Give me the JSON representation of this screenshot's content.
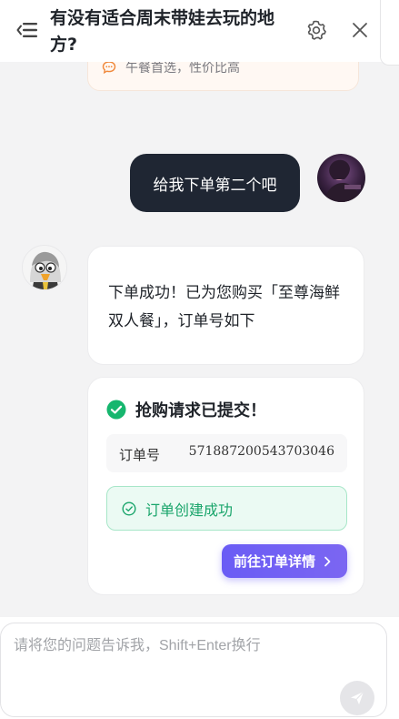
{
  "header": {
    "title": "有没有适合周末带娃去玩的地方?"
  },
  "messages": {
    "tip_text": "午餐首选，性价比高",
    "user_text": "给我下单第二个吧",
    "bot_text": "下单成功！已为您购买「至尊海鲜双人餐」，订单号如下"
  },
  "order": {
    "heading": "抢购请求已提交！",
    "number_label": "订单号",
    "number_value": "571887200543703046",
    "status_text": "订单创建成功",
    "detail_button": "前往订单详情"
  },
  "input": {
    "placeholder": "请将您的问题告诉我，Shift+Enter换行"
  },
  "colors": {
    "accent": "#6a5cf5",
    "success": "#1aa56b",
    "dark_bubble": "#1f2633"
  }
}
